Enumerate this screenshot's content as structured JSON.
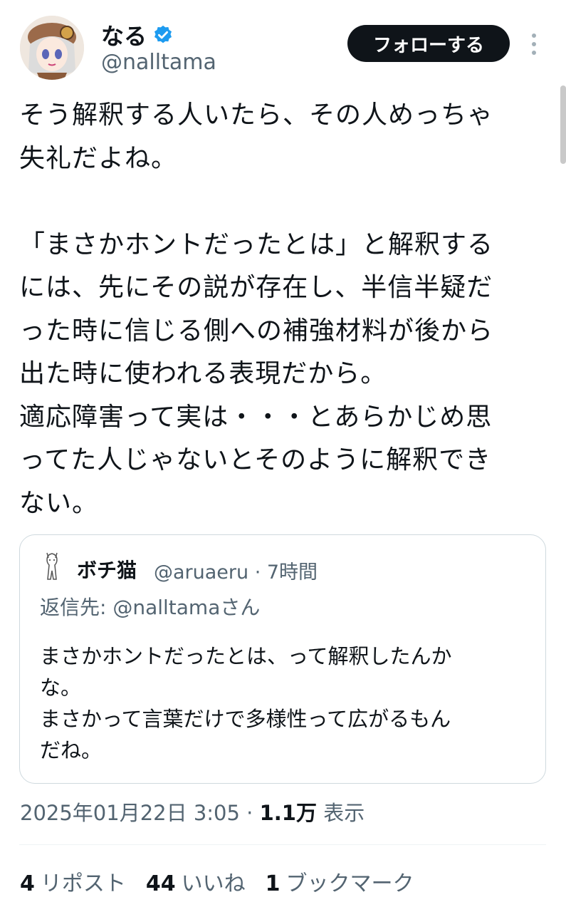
{
  "author": {
    "name": "なる",
    "handle": "@nalltama",
    "verified": true
  },
  "follow_button": {
    "label": "フォローする"
  },
  "tweet": {
    "text": "そう解釈する人いたら、その人めっちゃ\n失礼だよね。\n\n「まさかホントだったとは」と解釈する\nには、先にその説が存在し、半信半疑だ\nった時に信じる側への補強材料が後から\n出た時に使われる表現だから。\n適応障害って実は・・・とあらかじめ思\nってた人じゃないとそのように解釈でき\nない。"
  },
  "quote": {
    "name": "ボチ猫",
    "handle_time": "@aruaeru · 7時間",
    "reply_to": "返信先: @nalltamaさん",
    "text": "まさかホントだったとは、って解釈したんか\nな。\nまさかって言葉だけで多様性って広がるもん\nだね。"
  },
  "meta": {
    "datetime": "2025年01月22日 3:05 · ",
    "views": "1.1万",
    "views_label": " 表示"
  },
  "stats": {
    "reposts": {
      "count": "4",
      "label": "リポスト"
    },
    "likes": {
      "count": "44",
      "label": "いいね"
    },
    "bookmarks": {
      "count": "1",
      "label": "ブックマーク"
    }
  },
  "colors": {
    "accent": "#1d9bf0",
    "text": "#0f1419",
    "secondary": "#536471",
    "border": "#cfd9de"
  }
}
